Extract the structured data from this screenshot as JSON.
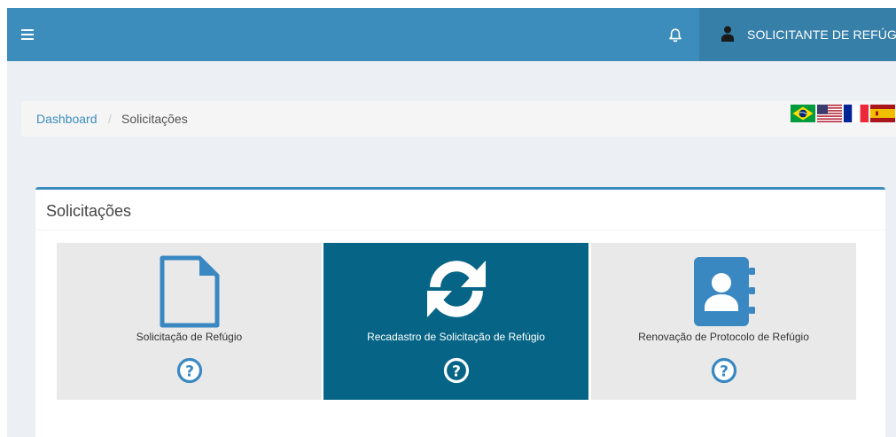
{
  "navbar": {
    "menu_icon": "hamburger-icon",
    "notification_icon": "bell-icon",
    "user_icon": "user-icon",
    "user_name": "SOLICITANTE DE REFÚGIO",
    "color": "#3c8dbc",
    "user_bg": "#367fa9"
  },
  "breadcrumb": {
    "home": "Dashboard",
    "separator": "/",
    "current": "Solicitações"
  },
  "languages": [
    {
      "icon": "flag-brazil-icon"
    },
    {
      "icon": "flag-usa-icon"
    },
    {
      "icon": "flag-france-icon"
    },
    {
      "icon": "flag-spain-icon"
    }
  ],
  "main": {
    "title": "Solicitações",
    "tiles": [
      {
        "label": "Solicitação de Refúgio",
        "icon": "document-icon",
        "help_icon": "question-circle-icon",
        "active": false
      },
      {
        "label": "Recadastro de Solicitação de Refúgio",
        "icon": "refresh-icon",
        "help_icon": "question-circle-icon",
        "active": true
      },
      {
        "label": "Renovação de Protocolo de Refúgio",
        "icon": "address-book-icon",
        "help_icon": "question-circle-icon",
        "active": false
      }
    ]
  },
  "colors": {
    "tile_bg": "#e9e9e9",
    "tile_active_bg": "#066586",
    "icon_blue": "#3a88c2"
  }
}
